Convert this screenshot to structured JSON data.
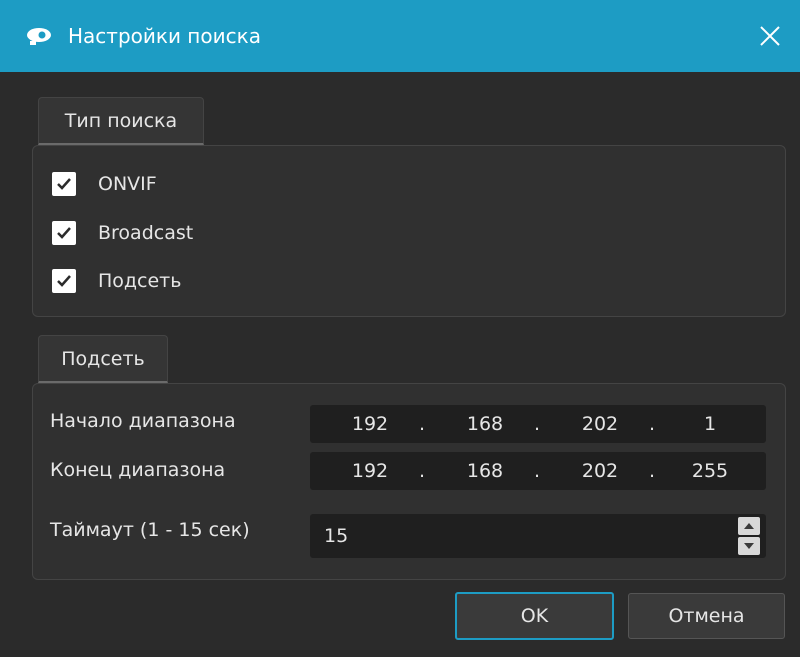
{
  "window": {
    "title": "Настройки поиска",
    "accent_color": "#1d9cc4"
  },
  "search_type": {
    "tab_label": "Тип поиска",
    "options": [
      {
        "label": "ONVIF",
        "checked": true
      },
      {
        "label": "Broadcast",
        "checked": true
      },
      {
        "label": "Подсеть",
        "checked": true
      }
    ]
  },
  "subnet": {
    "tab_label": "Подсеть",
    "range_start": {
      "label": "Начало диапазона",
      "octets": [
        "192",
        "168",
        "202",
        "1"
      ]
    },
    "range_end": {
      "label": "Конец диапазона",
      "octets": [
        "192",
        "168",
        "202",
        "255"
      ]
    },
    "timeout": {
      "label": "Таймаут (1 - 15 сек)",
      "value": "15"
    }
  },
  "buttons": {
    "ok": "OK",
    "cancel": "Отмена"
  },
  "icons": {
    "app": "camera-icon",
    "close": "close-icon",
    "check": "checkmark-icon",
    "up": "arrow-up-icon",
    "down": "arrow-down-icon"
  }
}
